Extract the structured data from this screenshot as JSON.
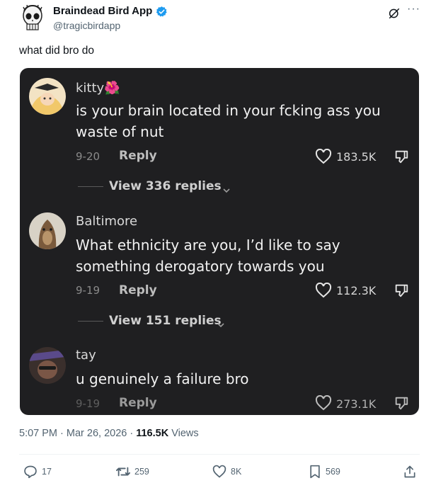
{
  "tweet": {
    "display_name": "Braindead Bird App",
    "handle": "@tragicbirdapp",
    "text": "what did bro do",
    "more_label": "···",
    "timestamp": "5:07 PM · Mar 26, 2026 · ",
    "views_count": "116.5K",
    "views_label": " Views"
  },
  "comments": [
    {
      "user": "kitty🌺",
      "text": "is your brain located in your fcking ass you waste of nut",
      "date": "9-20",
      "reply_label": "Reply",
      "likes": "183.5K",
      "view_replies": "View 336 replies"
    },
    {
      "user": "Baltimore",
      "text": "What ethnicity are you, I’d like to say something derogatory towards you",
      "date": "9-19",
      "reply_label": "Reply",
      "likes": "112.3K",
      "view_replies": "View 151 replies"
    },
    {
      "user": "tay",
      "text": "u genuinely a failure bro",
      "date": "9-19",
      "reply_label": "Reply",
      "likes": "273.1K"
    }
  ],
  "actions": {
    "replies": "17",
    "reposts": "259",
    "likes": "8K",
    "bookmarks": "569"
  },
  "icons": [
    "skull-avatar-icon",
    "verified-badge-icon",
    "grok-icon",
    "heart-icon",
    "dislike-icon",
    "reply-icon",
    "repost-icon",
    "bookmark-icon",
    "share-icon"
  ],
  "colors": {
    "verified": "#1d9bf0",
    "media_bg": "#1f1f21",
    "muted": "#536471"
  }
}
